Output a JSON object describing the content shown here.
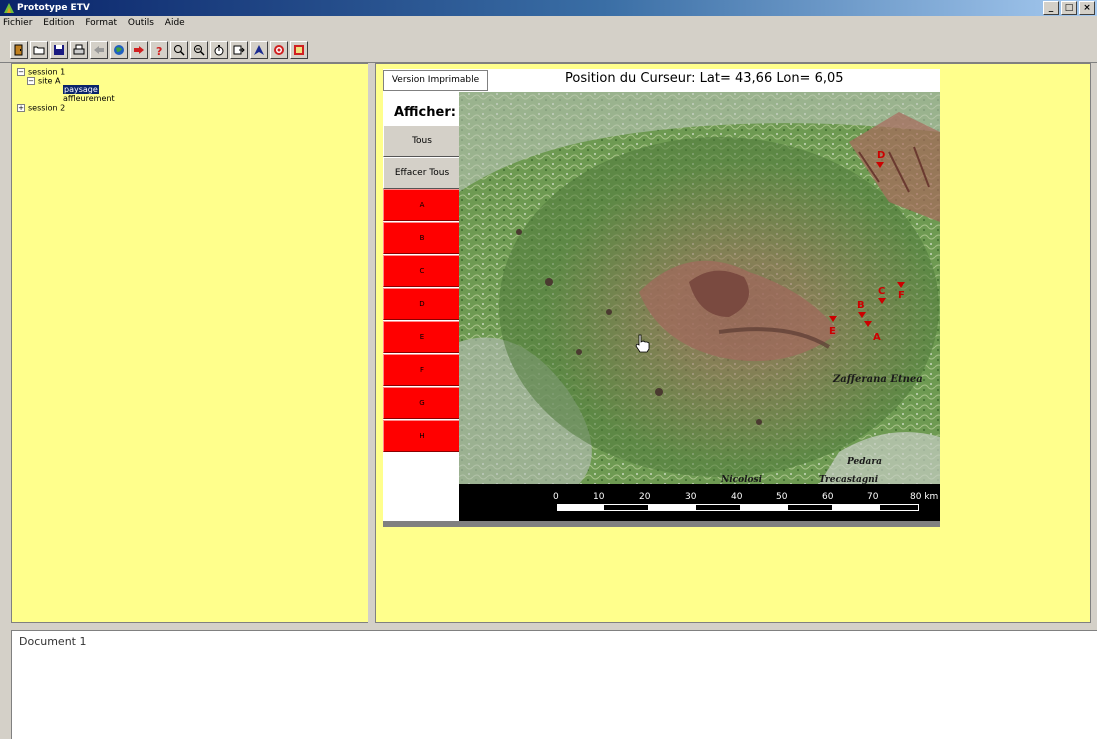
{
  "window": {
    "title": "Prototype ETV",
    "min": "_",
    "max": "□",
    "close": "×"
  },
  "menu": [
    "Fichier",
    "Edition",
    "Format",
    "Outils",
    "Aide"
  ],
  "toolbar_icons": [
    "exit-icon",
    "open-folder-icon",
    "save-icon",
    "print-icon",
    "back-arrow-icon",
    "globe-icon",
    "forward-arrow-icon",
    "help-icon",
    "zoom-in-icon",
    "zoom-out-icon",
    "timer-icon",
    "export-icon",
    "north-arrow-icon",
    "target-icon",
    "map-icon"
  ],
  "tree": {
    "session1": "session 1",
    "siteA": "site A",
    "paysage": "paysage",
    "affleurement": "affleurement",
    "session2": "session 2"
  },
  "map_app": {
    "print_button": "Version Imprimable",
    "cursor_position": "Position du Curseur:  Lat= 43,66 Lon= 6,05",
    "afficher_label": "Afficher:",
    "tous_button": "Tous",
    "effacer_button": "Effacer Tous",
    "site_buttons": [
      "A",
      "B",
      "C",
      "D",
      "E",
      "F",
      "G",
      "H"
    ],
    "site_color": "#ff0000",
    "map_markers": [
      "D",
      "C",
      "F",
      "B",
      "E",
      "A"
    ],
    "place_names": [
      "Zafferana Etnea",
      "Pedara",
      "Nicolosi",
      "Trecastagni"
    ],
    "scale_labels": [
      "0",
      "10",
      "20",
      "30",
      "40",
      "50",
      "60",
      "70",
      "80 km"
    ]
  },
  "document": {
    "title": "Document 1"
  },
  "colors": {
    "panel": "#ffff8c",
    "title_bar": "#0a246a",
    "marker": "#cc0000"
  }
}
